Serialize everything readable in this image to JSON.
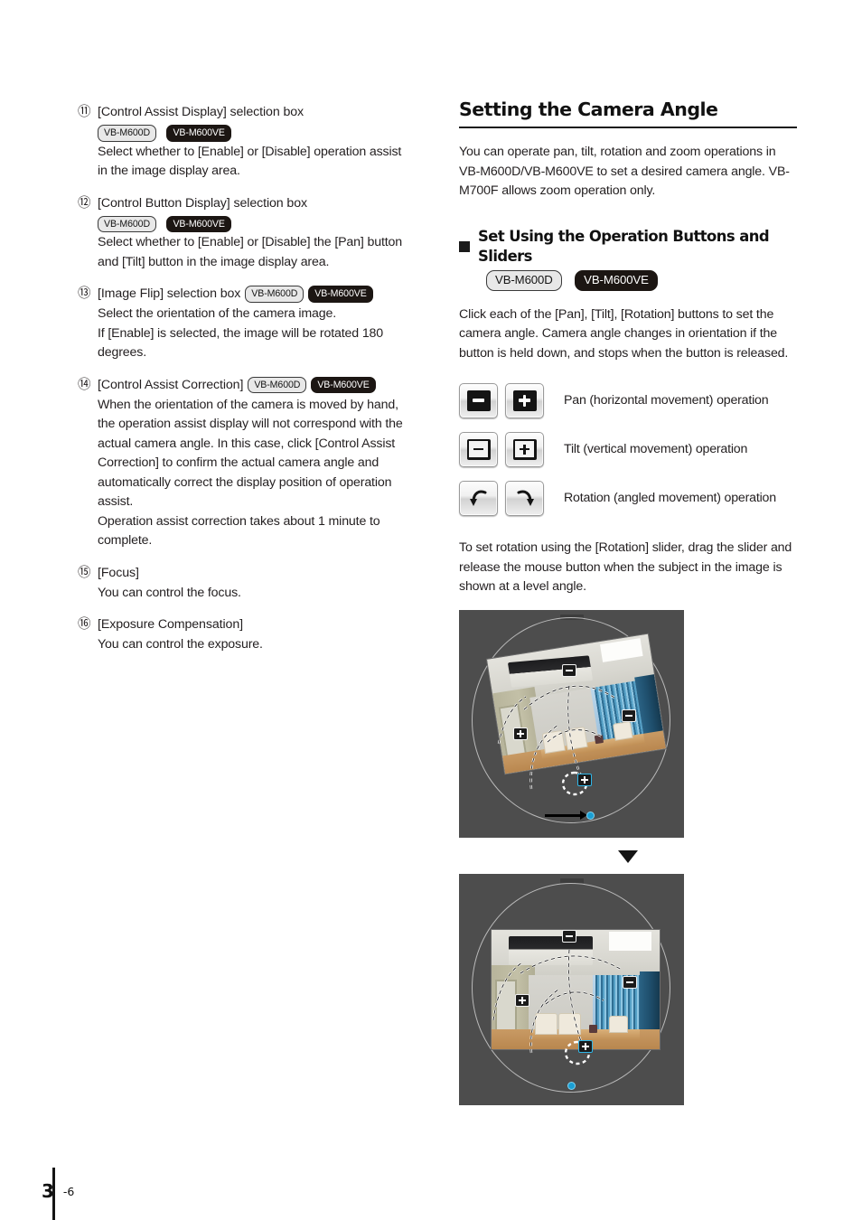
{
  "badges": {
    "m600d": "VB-M600D",
    "m600ve": "VB-M600VE"
  },
  "left_column": {
    "items": [
      {
        "num": "⑪",
        "head": "[Control Assist Display] selection box",
        "badges_below": true,
        "body": [
          "Select whether to [Enable] or [Disable] operation assist",
          "in the image display area."
        ]
      },
      {
        "num": "⑫",
        "head": "[Control Button Display] selection box",
        "badges_below": true,
        "body": [
          "Select whether to [Enable] or [Disable] the [Pan] button",
          "and [Tilt] button in the image display area."
        ]
      },
      {
        "num": "⑬",
        "head": "[Image Flip] selection box",
        "badges_inline": true,
        "body": [
          "Select the orientation of the camera image.",
          "If [Enable] is selected, the image will be rotated 180",
          "degrees."
        ]
      },
      {
        "num": "⑭",
        "head": "[Control Assist Correction]",
        "badges_inline": true,
        "body": [
          "When the orientation of the camera is moved by hand,",
          "the operation assist display will not correspond with the",
          "actual camera angle. In this case, click [Control Assist",
          "Correction] to confirm the actual camera angle and",
          "automatically correct the display position of operation",
          "assist.",
          "Operation assist correction takes about 1 minute to",
          "complete."
        ]
      },
      {
        "num": "⑮",
        "head": "[Focus]",
        "body": [
          "You can control the focus."
        ]
      },
      {
        "num": "⑯",
        "head": "[Exposure Compensation]",
        "body": [
          "You can control the exposure."
        ]
      }
    ]
  },
  "right_column": {
    "title": "Setting the Camera Angle",
    "intro": "You can operate pan, tilt, rotation and zoom operations in VB-M600D/VB-M600VE to set a desired camera angle. VB-M700F allows zoom operation only.",
    "section_heading": "Set Using the Operation Buttons and Sliders",
    "section_para": "Click each of the [Pan], [Tilt], [Rotation] buttons to set the camera angle. Camera angle changes in orientation if the button is held down, and stops when the button is released.",
    "button_legend": [
      {
        "label": "Pan (horizontal movement) operation",
        "kind": "pan"
      },
      {
        "label": "Tilt (vertical movement) operation",
        "kind": "tilt"
      },
      {
        "label": "Rotation (angled movement) operation",
        "kind": "rotation"
      }
    ],
    "slider_para": "To set rotation using the [Rotation] slider, drag the slider and release the mouse button when the subject in the image is shown at a level angle."
  },
  "footer": {
    "page_major": "3",
    "page_minor": "-6"
  },
  "colors": {
    "panel_bg": "#4d4d4d",
    "badge_dark": "#1c1613",
    "badge_light": "#e8e8e8",
    "slider_handle": "#1b9fd4",
    "rule": "#1a1a1a"
  }
}
